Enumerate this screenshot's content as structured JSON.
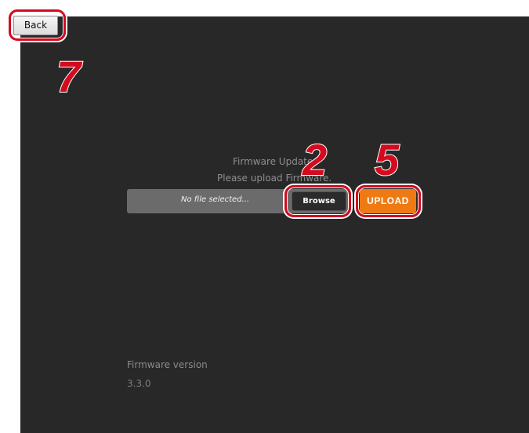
{
  "toolbar": {
    "back_label": "Back"
  },
  "annotations": {
    "back_step": "7",
    "browse_step": "2",
    "upload_step": "5"
  },
  "firmware_update": {
    "title": "Firmware Update",
    "instruction": "Please upload Firmware.",
    "file_status": "No file selected...",
    "browse_label": "Browse",
    "upload_label": "UPLOAD"
  },
  "firmware_info": {
    "version_label": "Firmware version",
    "version_value": "3.3.0"
  },
  "colors": {
    "panel_background": "#282828",
    "accent_upload": "#ef7a14",
    "callout_red": "#d40b1f"
  }
}
